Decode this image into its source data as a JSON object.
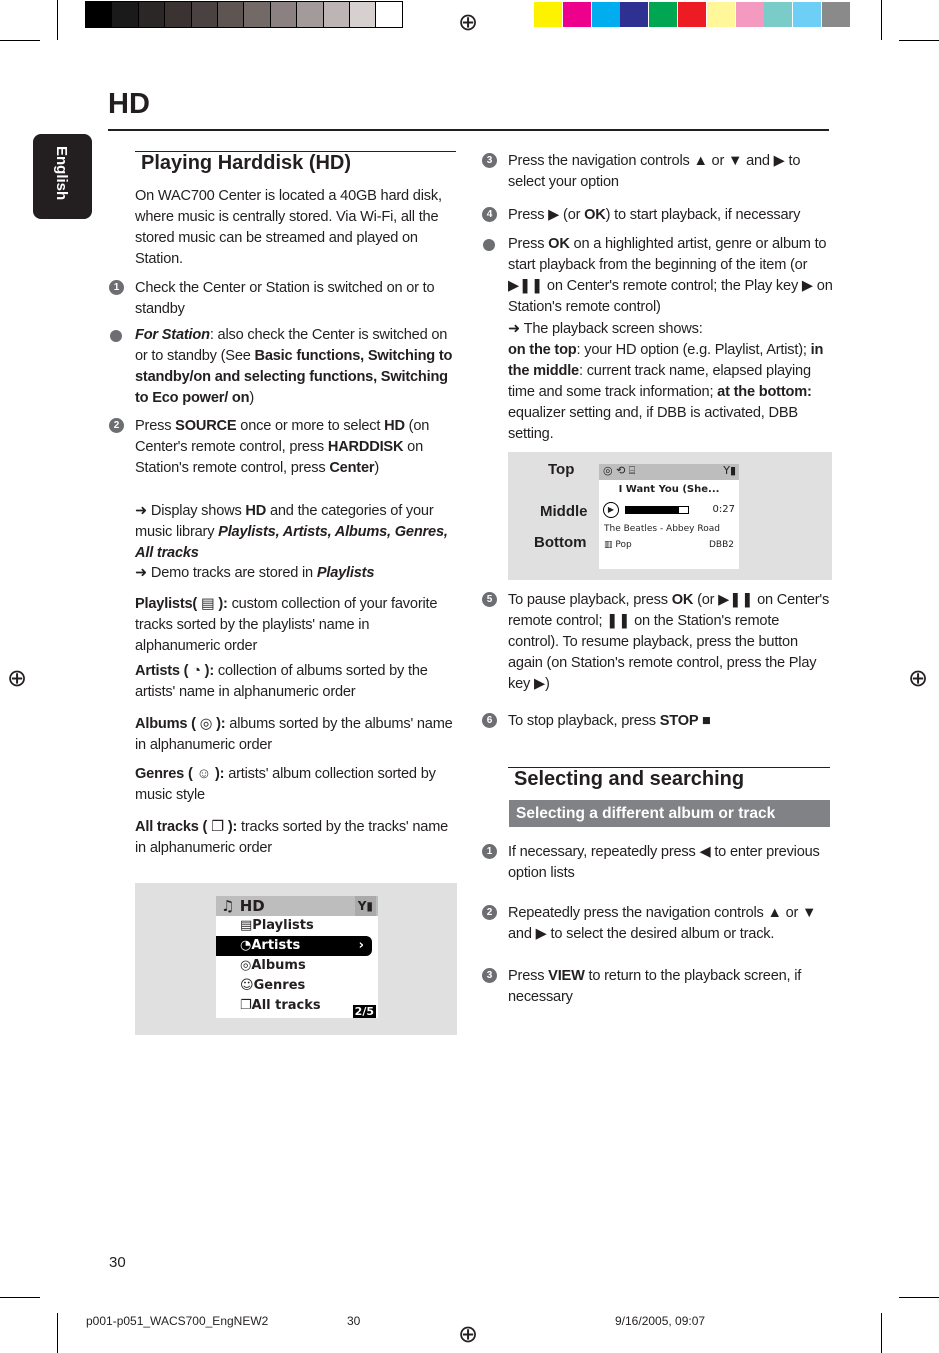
{
  "colors": {
    "gray_swatches": [
      "#000000",
      "#1a1a1a",
      "#2b2726",
      "#3a3332",
      "#4a4240",
      "#5e5553",
      "#736a68",
      "#8a8180",
      "#a39b9a",
      "#bdb5b4",
      "#d6d0cf",
      "#ffffff"
    ],
    "color_swatches": [
      "#fff200",
      "#ec008c",
      "#00aeef",
      "#2e3192",
      "#00a651",
      "#ed1c24",
      "#fff799",
      "#f49ac1",
      "#7accc8",
      "#6dcff6",
      "#8a8a8a"
    ]
  },
  "header": {
    "title": "HD",
    "language_tab": "English"
  },
  "left": {
    "heading": "Playing Harddisk (HD)",
    "paras": [
      {
        "segs": [
          {
            "t": "On WAC700 Center is located a 40GB hard disk, where music is centrally stored. Via Wi-Fi,  all the stored music can be streamed and played on Station.",
            "s": ""
          }
        ]
      },
      {
        "marker": "1",
        "segs": [
          {
            "t": "Check the Center or Station  is switched on or to standby",
            "s": ""
          }
        ]
      },
      {
        "marker": "dot",
        "segs": [
          {
            "t": "For Station",
            "s": "bi"
          },
          {
            "t": ": also check the Center is switched on or to standby (See ",
            "s": ""
          },
          {
            "t": "Basic functions, Switching to standby/on and selecting functions, Switching to Eco power/ on",
            "s": "b"
          },
          {
            "t": ")",
            "s": ""
          }
        ]
      },
      {
        "marker": "2",
        "segs": [
          {
            "t": "Press ",
            "s": ""
          },
          {
            "t": "SOURCE",
            "s": "b"
          },
          {
            "t": " once or more to select ",
            "s": ""
          },
          {
            "t": "HD",
            "s": "b"
          },
          {
            "t": " (on Center's remote control, press ",
            "s": ""
          },
          {
            "t": "HARDDISK",
            "s": "b"
          },
          {
            "t": " on Station's remote control, press ",
            "s": ""
          },
          {
            "t": "Center",
            "s": "b"
          },
          {
            "t": ")",
            "s": ""
          }
        ]
      },
      {
        "segs": [
          {
            "t": "➜ Display shows ",
            "s": ""
          },
          {
            "t": "HD",
            "s": "b"
          },
          {
            "t": " and the categories of your music library ",
            "s": ""
          },
          {
            "t": "Playlists,  Artists,  Albums, Genres,  All tracks",
            "s": "bi"
          }
        ]
      },
      {
        "segs": [
          {
            "t": "➜ Demo tracks are stored in ",
            "s": ""
          },
          {
            "t": "Playlists",
            "s": "bi"
          }
        ]
      },
      {
        "segs": [
          {
            "t": "Playlists( ",
            "s": "b"
          },
          {
            "t": "▤",
            "s": ""
          },
          {
            "t": " ):",
            "s": "b"
          },
          {
            "t": " custom collection of your favorite tracks sorted by the playlists' name in alphanumeric order",
            "s": ""
          }
        ]
      },
      {
        "segs": [
          {
            "t": "Artists ( ",
            "s": "b"
          },
          {
            "t": "◔",
            "s": ""
          },
          {
            "t": " ):",
            "s": "b"
          },
          {
            "t": " collection of albums sorted by the artists' name in alphanumeric order",
            "s": ""
          }
        ]
      },
      {
        "segs": [
          {
            "t": "Albums ( ",
            "s": "b"
          },
          {
            "t": "◎",
            "s": ""
          },
          {
            "t": " ):",
            "s": "b"
          },
          {
            "t": " albums sorted by the albums' name in alphanumeric order",
            "s": ""
          }
        ]
      },
      {
        "segs": [
          {
            "t": "Genres ( ",
            "s": "b"
          },
          {
            "t": "☺",
            "s": ""
          },
          {
            "t": " ):",
            "s": "b"
          },
          {
            "t": "  artists' album collection sorted by music style",
            "s": ""
          }
        ]
      },
      {
        "segs": [
          {
            "t": "All tracks ( ",
            "s": "b"
          },
          {
            "t": "❐",
            "s": ""
          },
          {
            "t": " ):",
            "s": "b"
          },
          {
            "t": " tracks sorted by the tracks' name in alphanumeric order",
            "s": ""
          }
        ]
      }
    ],
    "screen": {
      "title": "HD",
      "items": [
        "Playlists",
        "Artists",
        "Albums",
        "Genres",
        "All tracks"
      ],
      "selected": "Artists",
      "page": "2/5"
    }
  },
  "right": {
    "paras": [
      {
        "marker": "3",
        "segs": [
          {
            "t": "Press the navigation controls  ▲  or   ▼  and ▶ to select your option",
            "s": ""
          }
        ]
      },
      {
        "marker": "4",
        "segs": [
          {
            "t": "Press ▶  (or ",
            "s": ""
          },
          {
            "t": "OK",
            "s": "b"
          },
          {
            "t": ") to start playback, if necessary",
            "s": ""
          }
        ]
      },
      {
        "marker": "dot",
        "segs": [
          {
            "t": "Press ",
            "s": ""
          },
          {
            "t": "OK",
            "s": "b"
          },
          {
            "t": " on a highlighted artist, genre or album to start playback from the beginning of the item (or ▶❚❚  on Center's remote control; the Play key ▶  on Station's remote control)",
            "s": ""
          }
        ]
      },
      {
        "segs": [
          {
            "t": "➜ The playback screen shows:",
            "s": ""
          }
        ]
      },
      {
        "segs": [
          {
            "t": "on the top",
            "s": "b"
          },
          {
            "t": ": your HD option (e.g. Playlist, Artist); ",
            "s": ""
          },
          {
            "t": "in the middle",
            "s": "b"
          },
          {
            "t": ": current track name, elapsed playing time and some track information; ",
            "s": ""
          },
          {
            "t": "at the bottom:",
            "s": "b"
          },
          {
            "t": " equalizer setting and, if DBB is activated, DBB setting.",
            "s": ""
          }
        ]
      },
      {
        "marker": "5",
        "segs": [
          {
            "t": "To pause playback, press ",
            "s": ""
          },
          {
            "t": "OK",
            "s": "b"
          },
          {
            "t": " (or ▶❚❚  on Center's remote control;  ❚❚  on the Station's remote control).  To resume playback, press the button again (on Station's remote control, press the Play key ▶)",
            "s": ""
          }
        ]
      },
      {
        "marker": "6",
        "segs": [
          {
            "t": "To stop playback, press ",
            "s": ""
          },
          {
            "t": "STOP ■",
            "s": "b"
          }
        ]
      },
      {
        "marker": "1",
        "segs": [
          {
            "t": "If necessary, repeatedly press ◀  to enter previous option lists",
            "s": ""
          }
        ]
      },
      {
        "marker": "2",
        "segs": [
          {
            "t": "Repeatedly press the navigation controls  ▲  or ▼  and ▶  to select the desired album or track.",
            "s": ""
          }
        ]
      },
      {
        "marker": "3",
        "segs": [
          {
            "t": "Press ",
            "s": ""
          },
          {
            "t": "VIEW",
            "s": "b"
          },
          {
            "t": "  to return to the playback screen, if necessary",
            "s": ""
          }
        ]
      }
    ],
    "screen": {
      "labels": [
        "Top",
        "Middle",
        "Bottom"
      ],
      "track": "I Want You (She...",
      "elapsed": "0:27",
      "progress": 0.85,
      "info": "The Beatles - Abbey Road",
      "eq": "Pop",
      "dbb": "DBB2"
    },
    "heading": "Selecting and searching",
    "subheading": "Selecting a different album or track"
  },
  "footer": {
    "page_number": "30",
    "file": "p001-p051_WACS700_EngNEW2",
    "file_page": "30",
    "date": "9/16/2005, 09:07"
  }
}
